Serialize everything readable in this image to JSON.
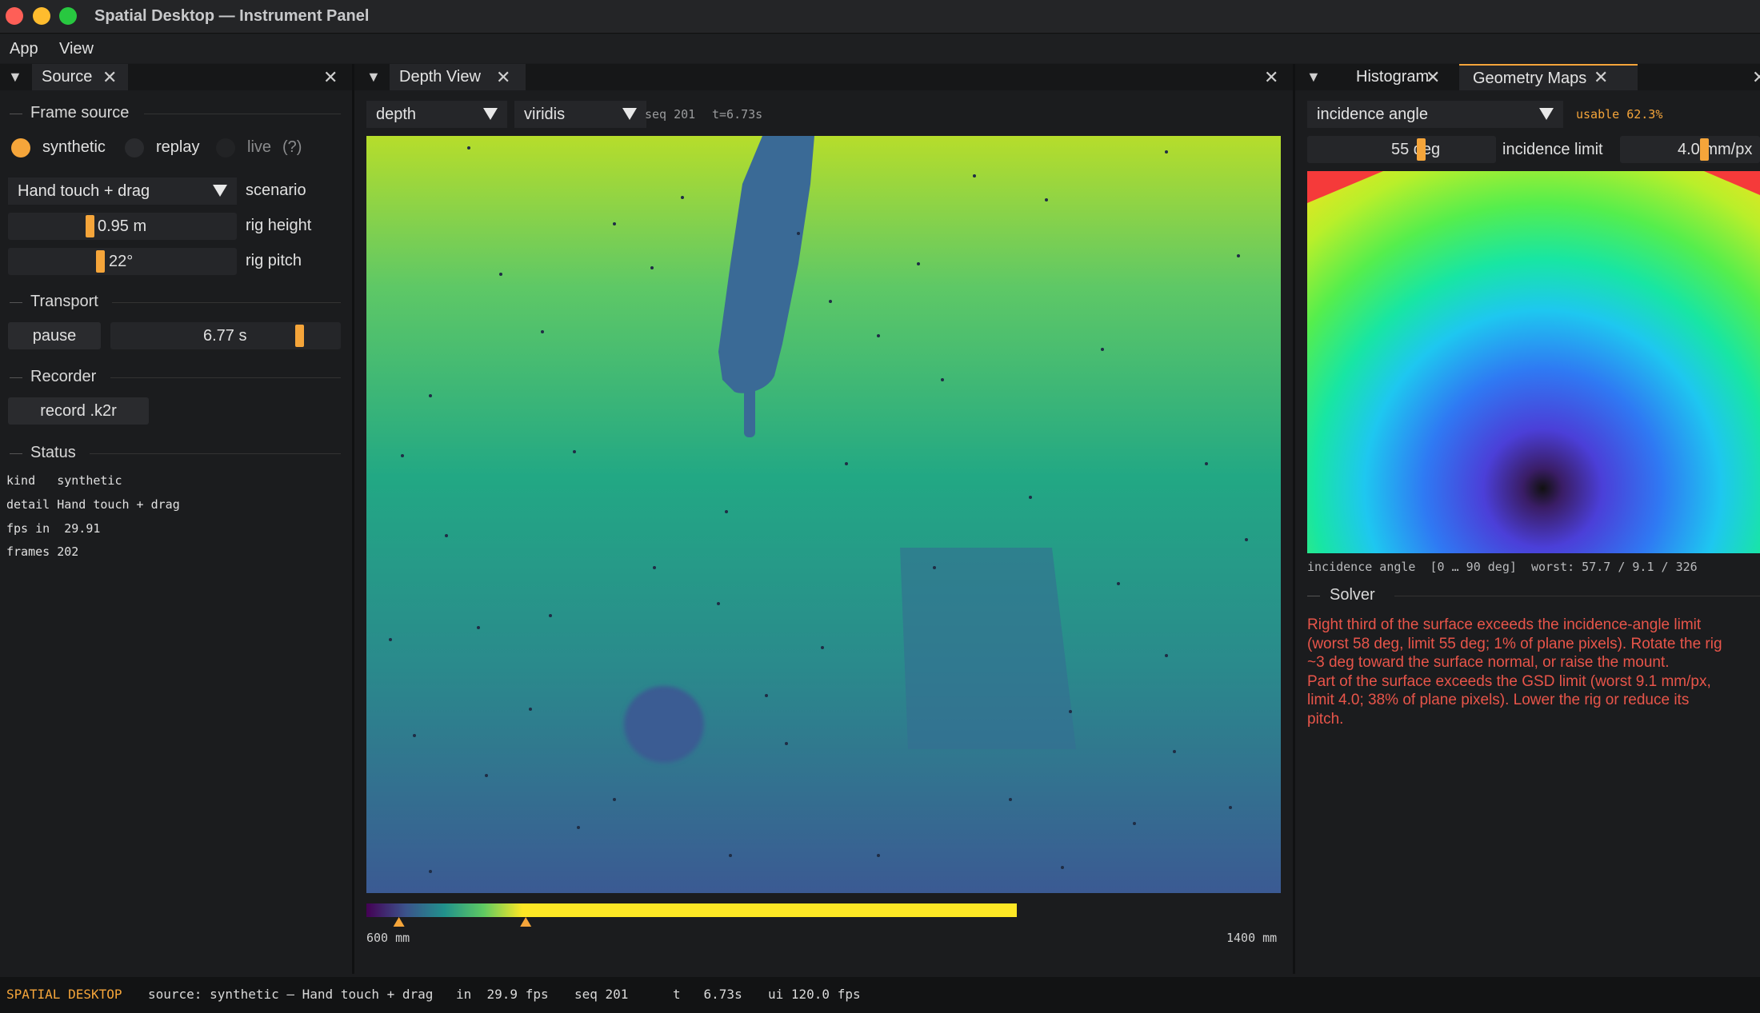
{
  "window": {
    "title": "Spatial Desktop — Instrument Panel"
  },
  "menu": [
    "App",
    "View"
  ],
  "source_panel": {
    "tab": "Source",
    "frame_source": {
      "heading": "Frame source",
      "options": [
        "synthetic",
        "replay",
        "live"
      ],
      "selected": "synthetic",
      "help": "(?)"
    },
    "scenario": {
      "value": "Hand touch + drag",
      "label": "scenario"
    },
    "rig_height": {
      "value": "0.95 m",
      "label": "rig height",
      "fraction": 0.37
    },
    "rig_pitch": {
      "value": "22°",
      "label": "rig pitch",
      "fraction": 0.42
    },
    "transport": {
      "heading": "Transport",
      "pause_label": "pause",
      "time": "6.77 s",
      "fraction": 0.83
    },
    "recorder": {
      "heading": "Recorder",
      "record_label": "record .k2r"
    },
    "status": {
      "heading": "Status",
      "lines": [
        "kind   synthetic",
        "detail Hand touch + drag",
        "fps in  29.91",
        "frames 202"
      ]
    }
  },
  "depth_panel": {
    "tab": "Depth View",
    "channel": "depth",
    "colormap": "viridis",
    "seq": "seq 201",
    "time": "t=6.73s",
    "colorbar": {
      "min_label": "600 mm",
      "max_label": "1400 mm",
      "marker_low": 0.05,
      "marker_high": 0.245
    }
  },
  "right_panel": {
    "tabs": [
      "Histogram",
      "Geometry Maps"
    ],
    "active_tab": "Geometry Maps",
    "map_select": "incidence angle",
    "usable": "usable 62.3%",
    "incidence_value": "55 deg",
    "incidence_label": "incidence limit",
    "gsd_value": "4.0 mm/px",
    "caption": "incidence angle  [0 … 90 deg]  worst: 57.7 / 9.1 / 326",
    "solver": {
      "heading": "Solver",
      "lines": [
        "Right third of the surface exceeds the incidence-angle limit",
        "(worst 58 deg, limit 55 deg; 1% of plane pixels). Rotate the rig",
        "~3 deg toward the surface normal, or raise the mount.",
        "Part of the surface exceeds the GSD limit (worst 9.1 mm/px,",
        "limit 4.0; 38% of plane pixels). Lower the rig or reduce its",
        "pitch."
      ]
    }
  },
  "statusbar": {
    "app": "SPATIAL DESKTOP",
    "source": "source: synthetic — Hand touch + drag",
    "in": "in  29.9 fps",
    "seq": "seq 201",
    "t": "t   6.73s",
    "ui": "ui 120.0 fps"
  },
  "colors": {
    "accent": "#f5a53a",
    "solver_text": "#e8554a",
    "background": "#1b1c1e",
    "usable": "#f5a53a"
  }
}
